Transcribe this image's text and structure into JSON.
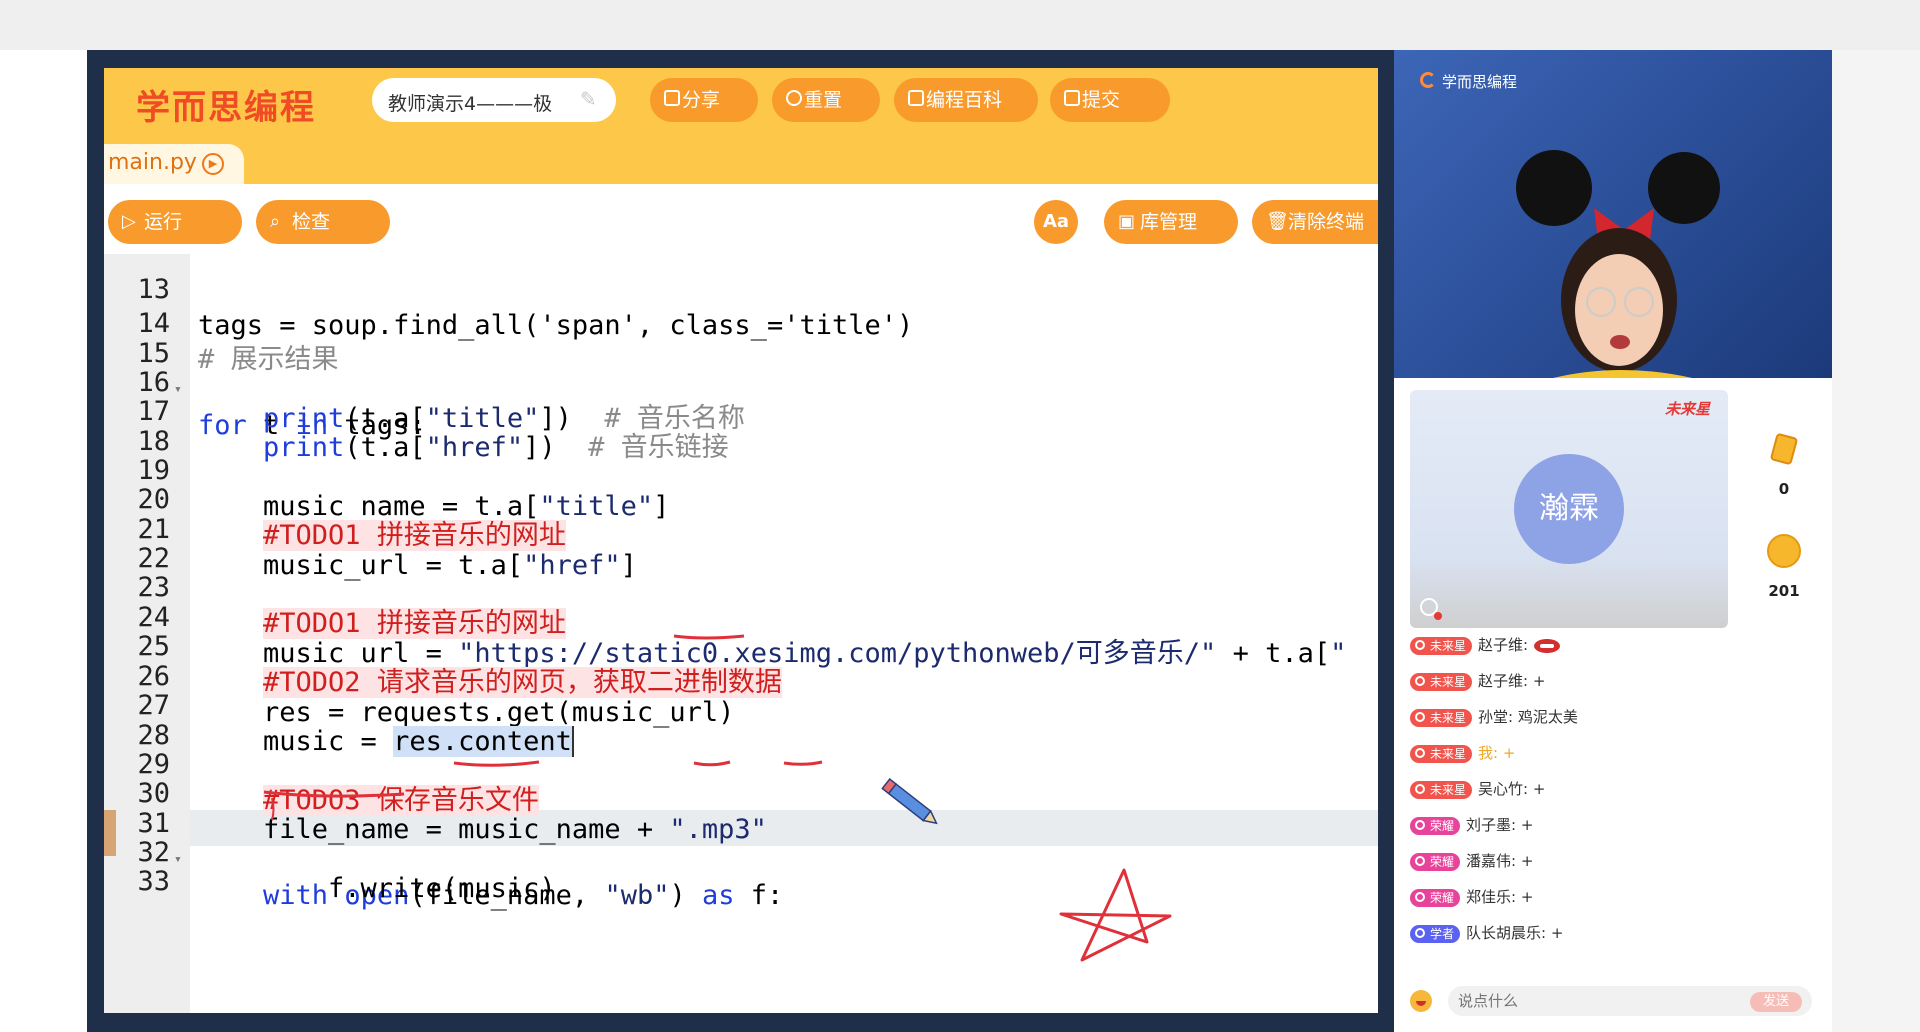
{
  "ide": {
    "logo": "学而思编程",
    "project_title": "教师演示4———极",
    "buttons": {
      "share": "分享",
      "reset": "重置",
      "wiki": "编程百科",
      "submit": "提交"
    },
    "file_tab": "main.py",
    "toolbar": {
      "run": "运行",
      "check": "检查",
      "font": "Aa",
      "library": "库管理",
      "clear": "清除终端"
    }
  },
  "editor": {
    "active_line": 27,
    "partial_top_line": "tags = soup.find_all('span', class_='title')",
    "lines": [
      {
        "n": "13",
        "text": ""
      },
      {
        "n": "14",
        "text": ""
      },
      {
        "n": "15",
        "text": ""
      },
      {
        "n": "16",
        "text": ""
      },
      {
        "n": "17",
        "text": ""
      },
      {
        "n": "18",
        "text": ""
      },
      {
        "n": "19",
        "text": ""
      },
      {
        "n": "20",
        "text": ""
      },
      {
        "n": "21",
        "text": ""
      },
      {
        "n": "22",
        "text": ""
      },
      {
        "n": "23",
        "text": ""
      },
      {
        "n": "24",
        "text": ""
      },
      {
        "n": "25",
        "text": ""
      },
      {
        "n": "26",
        "text": ""
      },
      {
        "n": "27",
        "text": ""
      },
      {
        "n": "28",
        "text": ""
      },
      {
        "n": "29",
        "text": ""
      },
      {
        "n": "30",
        "text": ""
      },
      {
        "n": "31",
        "text": ""
      },
      {
        "n": "32",
        "text": ""
      },
      {
        "n": "33",
        "text": ""
      }
    ]
  },
  "webcam": {
    "logo": "学而思编程"
  },
  "profile_card": {
    "avatar_text": "瀚霖",
    "badge": "未来星"
  },
  "stats": [
    {
      "icon": "card-icon",
      "value": "0"
    },
    {
      "icon": "idol-coin-icon",
      "value": "201"
    }
  ],
  "chat": [
    {
      "badge": "未来星",
      "badge_color": "#f0544c",
      "name": "赵子维:",
      "msg": ""
    },
    {
      "badge": "未来星",
      "badge_color": "#f0544c",
      "name": "赵子维:",
      "msg": "+"
    },
    {
      "badge": "未来星",
      "badge_color": "#f0544c",
      "name": "孙堂:",
      "msg": "鸡泥太美"
    },
    {
      "badge": "未来星",
      "badge_color": "#f0544c",
      "name": "我:",
      "msg": "+"
    },
    {
      "badge": "未来星",
      "badge_color": "#f0544c",
      "name": "吴心竹:",
      "msg": "+"
    },
    {
      "badge": "荣耀",
      "badge_color": "#e8439a",
      "name": "刘子墨:",
      "msg": "+"
    },
    {
      "badge": "荣耀",
      "badge_color": "#e8439a",
      "name": "潘嘉伟:",
      "msg": "+"
    },
    {
      "badge": "荣耀",
      "badge_color": "#e8439a",
      "name": "郑佳乐:",
      "msg": "+"
    },
    {
      "badge": "学者",
      "badge_color": "#5b62f2",
      "name": "队长胡晨乐:",
      "msg": "+"
    }
  ],
  "chat_input": {
    "placeholder": "说点什么",
    "send": "发送"
  },
  "colors": {
    "header": "#fdc84a",
    "button": "#f89a2c",
    "logo": "#f04b25",
    "annotation": "#e0303a"
  }
}
